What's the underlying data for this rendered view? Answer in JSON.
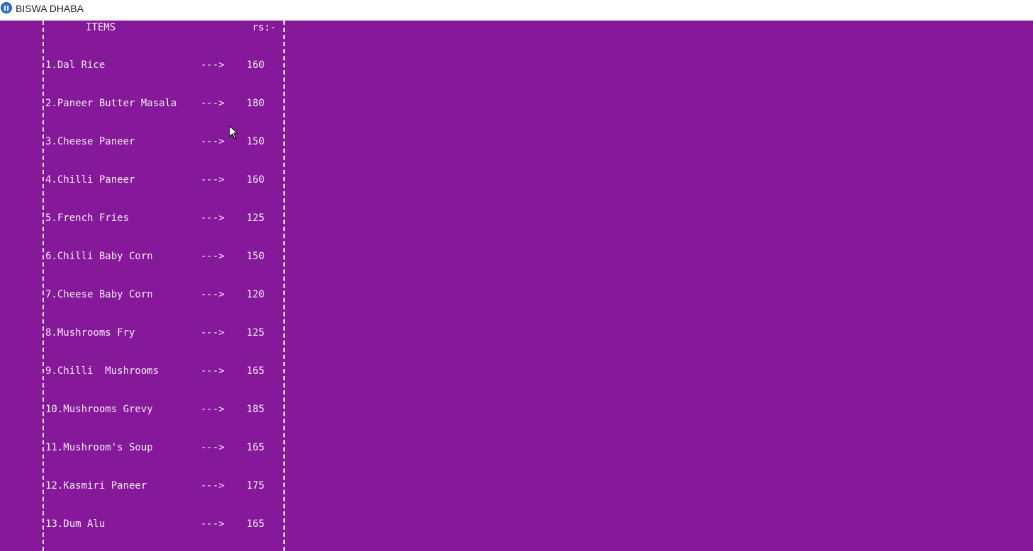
{
  "window": {
    "title": "BISWA DHABA",
    "icon": "app-icon"
  },
  "menu": {
    "header_items": "ITEMS",
    "header_price": "rs:-",
    "items": [
      {
        "name": "1.Dal Rice",
        "arrow": "--->",
        "price": "160"
      },
      {
        "name": "2.Paneer Butter Masala",
        "arrow": "--->",
        "price": "180"
      },
      {
        "name": "3.Cheese Paneer",
        "arrow": "--->",
        "price": "150"
      },
      {
        "name": "4.Chilli Paneer",
        "arrow": "--->",
        "price": "160"
      },
      {
        "name": "5.French Fries",
        "arrow": "--->",
        "price": "125"
      },
      {
        "name": "6.Chilli Baby Corn",
        "arrow": "--->",
        "price": "150"
      },
      {
        "name": "7.Cheese Baby Corn",
        "arrow": "--->",
        "price": "120"
      },
      {
        "name": "8.Mushrooms Fry",
        "arrow": "--->",
        "price": "125"
      },
      {
        "name": "9.Chilli  Mushrooms",
        "arrow": "--->",
        "price": "165"
      },
      {
        "name": "10.Mushrooms Grevy",
        "arrow": "--->",
        "price": "185"
      },
      {
        "name": "11.Mushroom's Soup",
        "arrow": "--->",
        "price": "165"
      },
      {
        "name": "12.Kasmiri Paneer",
        "arrow": "--->",
        "price": "175"
      },
      {
        "name": "13.Dum Alu",
        "arrow": "--->",
        "price": "165"
      }
    ]
  },
  "colors": {
    "background": "#86189a",
    "text": "#f5e9f7",
    "titlebar": "#ffffff"
  }
}
